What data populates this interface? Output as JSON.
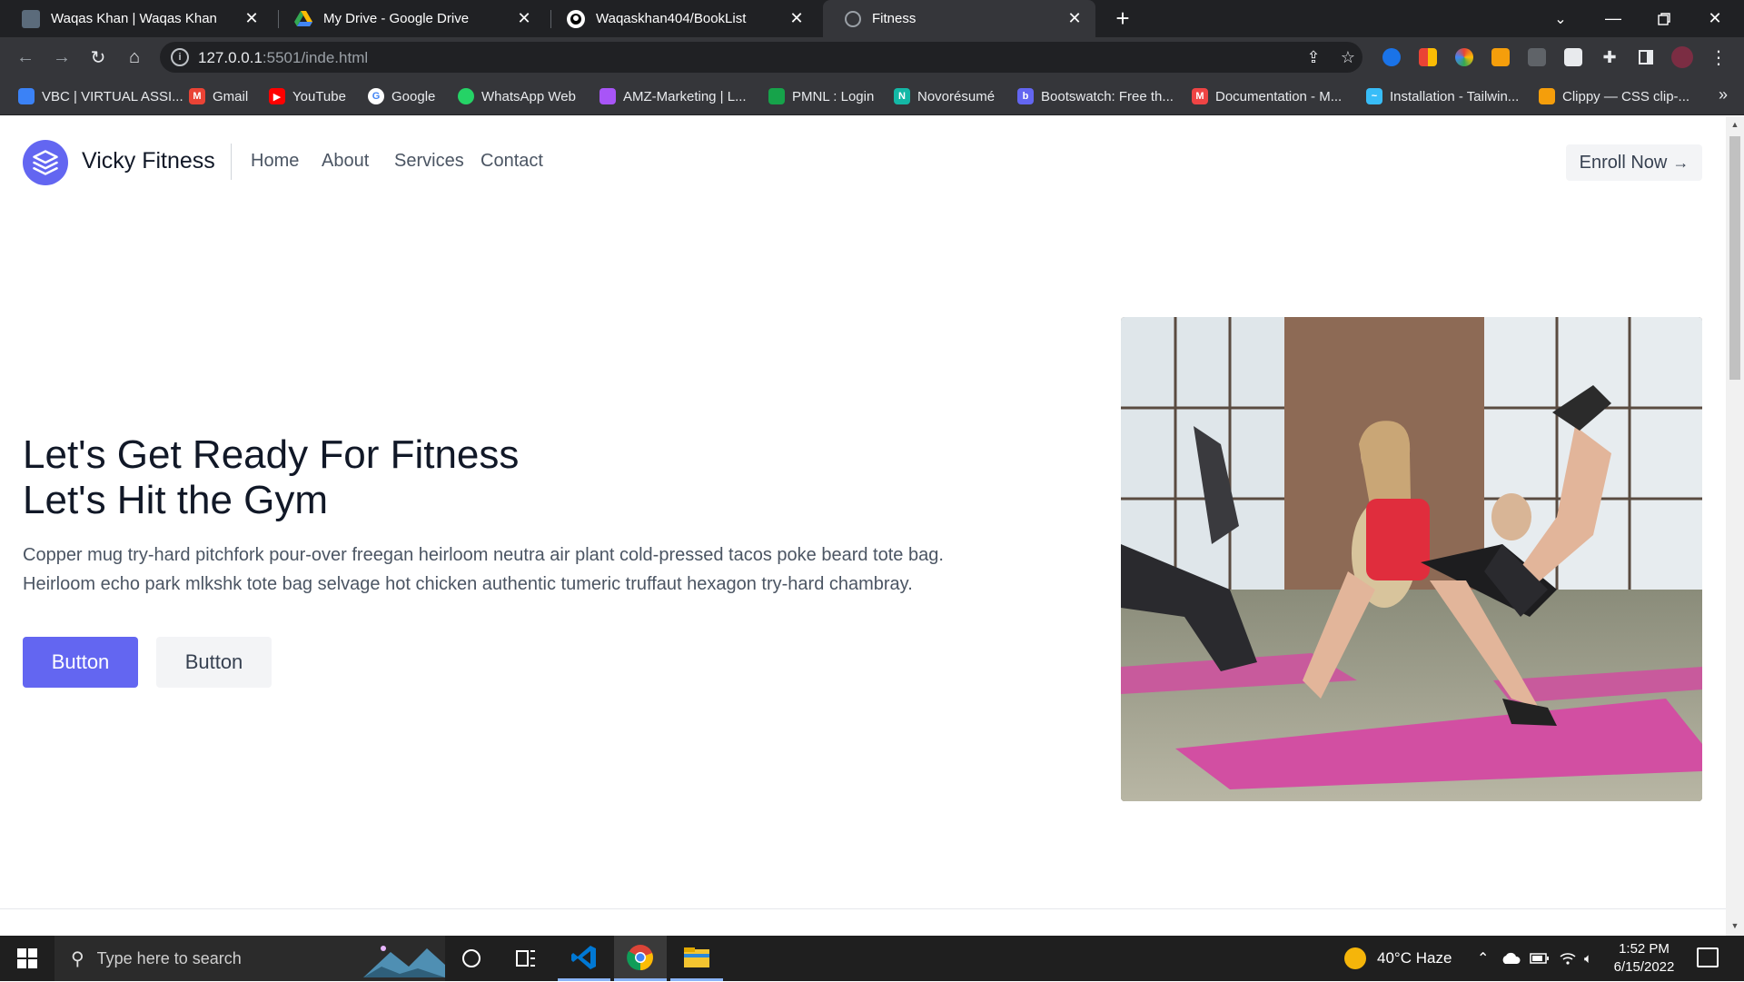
{
  "browser": {
    "tabs": [
      {
        "title": "Waqas Khan | Waqas Khan",
        "active": false
      },
      {
        "title": "My Drive - Google Drive",
        "active": false
      },
      {
        "title": "Waqaskhan404/BookList",
        "active": false
      },
      {
        "title": "Fitness",
        "active": true
      }
    ],
    "url_host": "127.0.0.1",
    "url_rest": ":5501/inde.html",
    "bookmarks": [
      {
        "label": "VBC | VIRTUAL ASSI...",
        "color": "#3b82f6"
      },
      {
        "label": "Gmail",
        "color": "#ea4335"
      },
      {
        "label": "YouTube",
        "color": "#ff0000"
      },
      {
        "label": "Google",
        "color": "#4285f4"
      },
      {
        "label": "WhatsApp Web",
        "color": "#25d366"
      },
      {
        "label": "AMZ-Marketing | L...",
        "color": "#a855f7"
      },
      {
        "label": "PMNL : Login",
        "color": "#16a34a"
      },
      {
        "label": "Novorésumé",
        "color": "#14b8a6"
      },
      {
        "label": "Bootswatch: Free th...",
        "color": "#6366f1"
      },
      {
        "label": "Documentation - M...",
        "color": "#ef4444"
      },
      {
        "label": "Installation - Tailwin...",
        "color": "#38bdf8"
      },
      {
        "label": "Clippy — CSS clip-...",
        "color": "#f59e0b"
      }
    ]
  },
  "site": {
    "brand": "Vicky Fitness",
    "nav": [
      "Home",
      "About",
      "Services",
      "Contact"
    ],
    "enroll_label": "Enroll Now",
    "hero_line1": "Let's Get Ready For Fitness",
    "hero_line2": "Let's Hit the Gym",
    "hero_text_line1": "Copper mug try-hard pitchfork pour-over freegan heirloom neutra air plant cold-pressed tacos poke beard tote bag.",
    "hero_text_line2": "Heirloom echo park mlkshk tote bag selvage hot chicken authentic tumeric truffaut hexagon try-hard chambray.",
    "primary_button": "Button",
    "secondary_button": "Button",
    "accent_color": "#6366f1"
  },
  "taskbar": {
    "search_placeholder": "Type here to search",
    "weather": "40°C  Haze",
    "time": "1:52 PM",
    "date": "6/15/2022"
  }
}
